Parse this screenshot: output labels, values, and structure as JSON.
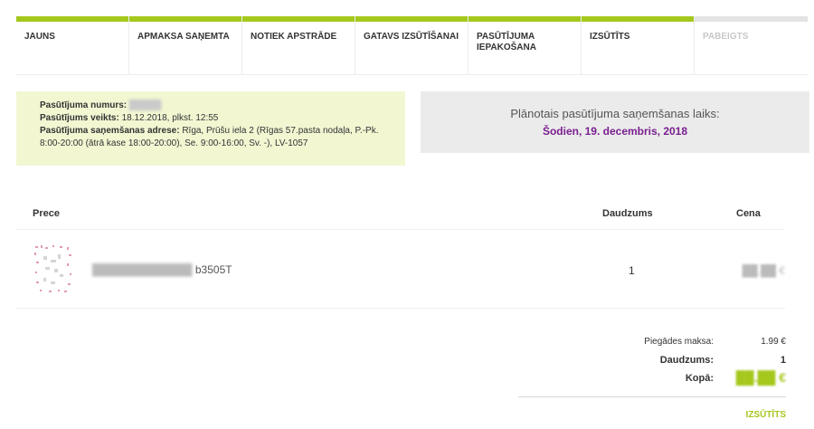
{
  "steps": [
    {
      "label": "Jauns",
      "state": "done"
    },
    {
      "label": "Apmaksa saņemta",
      "state": "done"
    },
    {
      "label": "Notiek apstrāde",
      "state": "done"
    },
    {
      "label": "Gatavs izsūtīšanai",
      "state": "done"
    },
    {
      "label": "Pasūtījuma iepakošana",
      "state": "done"
    },
    {
      "label": "Izsūtīts",
      "state": "current"
    },
    {
      "label": "Pabeigts",
      "state": "inactive"
    }
  ],
  "order": {
    "number_label": "Pasūtījuma numurs:",
    "number_value": "",
    "placed_label": "Pasūtījums veikts:",
    "placed_value": "18.12.2018, plkst. 12:55",
    "address_label": "Pasūtījuma saņemšanas adrese:",
    "address_value": "Rīga, Prūšu iela 2 (Rīgas 57.pasta nodaļa, P.-Pk. 8:00-20:00 (ātrā kase 18:00-20:00), Se. 9:00-16:00, Sv. -), LV-1057"
  },
  "delivery": {
    "label": "Plānotais pasūtījuma saņemšanas laiks:",
    "date": "Šodien, 19. decembris, 2018"
  },
  "table": {
    "col_product": "Prece",
    "col_qty": "Daudzums",
    "col_price": "Cena"
  },
  "product": {
    "name_visible": "b3505T",
    "qty": "1",
    "price": ""
  },
  "totals": {
    "shipping_label": "Piegādes maksa:",
    "shipping_value": "1.99 €",
    "qty_label": "Daudzums:",
    "qty_value": "1",
    "total_label": "Kopā:",
    "total_value": ""
  },
  "status_link": "Izsūtīts",
  "colors": {
    "accent": "#a5c81c",
    "date": "#7a1f8f",
    "info_bg": "#f2f7d2",
    "delivery_bg": "#ebebeb"
  }
}
